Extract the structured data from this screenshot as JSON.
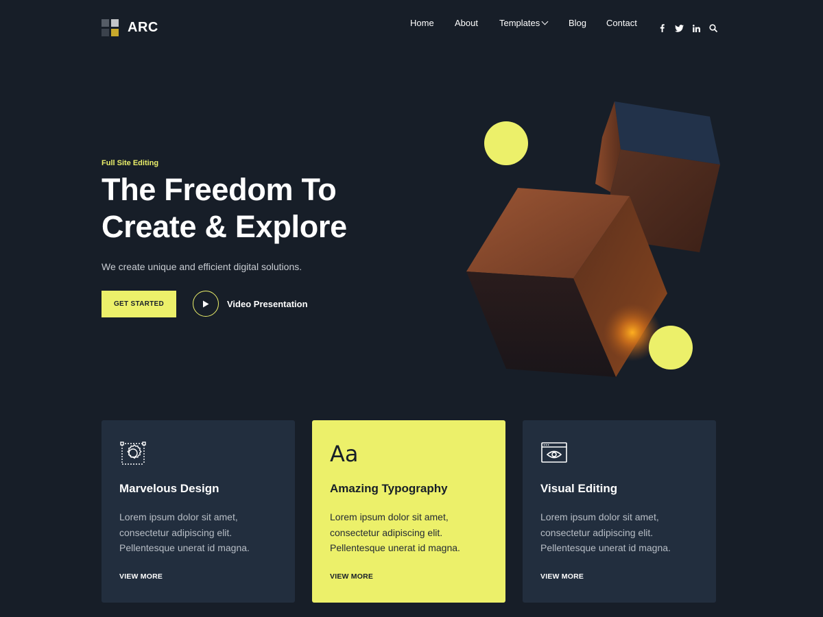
{
  "brand": {
    "name": "ARC"
  },
  "nav": {
    "items": [
      {
        "label": "Home"
      },
      {
        "label": "About"
      },
      {
        "label": "Templates"
      },
      {
        "label": "Blog"
      },
      {
        "label": "Contact"
      }
    ],
    "social": [
      "facebook-icon",
      "twitter-icon",
      "linkedin-icon",
      "search-icon"
    ]
  },
  "hero": {
    "kicker": "Full Site Editing",
    "title_line1": "The Freedom To",
    "title_line2": "Create & Explore",
    "subtitle": "We create unique and efficient digital solutions.",
    "cta_label": "GET STARTED",
    "video_label": "Video Presentation"
  },
  "cards": [
    {
      "title": "Marvelous Design",
      "text": "Lorem ipsum dolor sit amet, consectetur adipiscing elit. Pellentesque unerat id magna.",
      "link": "VIEW MORE",
      "icon": "design-gear-icon"
    },
    {
      "title": "Amazing Typography",
      "text": "Lorem ipsum dolor sit amet, consectetur adipiscing elit. Pellentesque unerat id magna.",
      "link": "VIEW MORE",
      "icon_text": "Aa"
    },
    {
      "title": "Visual Editing",
      "text": "Lorem ipsum dolor sit amet, consectetur adipiscing elit. Pellentesque unerat id magna.",
      "link": "VIEW MORE",
      "icon": "browser-eye-icon"
    }
  ],
  "colors": {
    "background": "#171e28",
    "card": "#222e3e",
    "accent": "#ecf06a"
  }
}
